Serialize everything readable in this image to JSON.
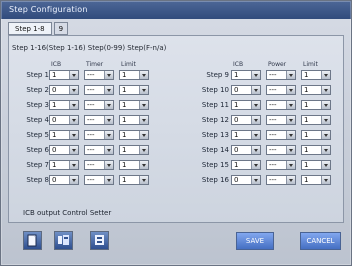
{
  "window": {
    "title": "Step Configuration"
  },
  "tabs": [
    {
      "label": "Step 1-8"
    },
    {
      "label": "9"
    }
  ],
  "header": {
    "text": "Step 1-16(Step 1-16) Step(0-99) Step(F-n/a)"
  },
  "columns": {
    "left": [
      "ICB",
      "Timer",
      "Limit"
    ],
    "right": [
      "ICB",
      "Power",
      "Limit"
    ]
  },
  "rows": {
    "left": [
      {
        "label": "Step 1",
        "values": [
          "1",
          "---",
          "1"
        ]
      },
      {
        "label": "Step 2",
        "values": [
          "0",
          "---",
          "1"
        ]
      },
      {
        "label": "Step 3",
        "values": [
          "1",
          "---",
          "1"
        ]
      },
      {
        "label": "Step 4",
        "values": [
          "0",
          "---",
          "1"
        ]
      },
      {
        "label": "Step 5",
        "values": [
          "1",
          "---",
          "1"
        ]
      },
      {
        "label": "Step 6",
        "values": [
          "0",
          "---",
          "1"
        ]
      },
      {
        "label": "Step 7",
        "values": [
          "1",
          "---",
          "1"
        ]
      },
      {
        "label": "Step 8",
        "values": [
          "0",
          "---",
          "1"
        ]
      }
    ],
    "right": [
      {
        "label": "Step 9",
        "values": [
          "1",
          "---",
          "1"
        ]
      },
      {
        "label": "Step 10",
        "values": [
          "0",
          "---",
          "1"
        ]
      },
      {
        "label": "Step 11",
        "values": [
          "1",
          "---",
          "1"
        ]
      },
      {
        "label": "Step 12",
        "values": [
          "0",
          "---",
          "1"
        ]
      },
      {
        "label": "Step 13",
        "values": [
          "1",
          "---",
          "1"
        ]
      },
      {
        "label": "Step 14",
        "values": [
          "0",
          "---",
          "1"
        ]
      },
      {
        "label": "Step 15",
        "values": [
          "1",
          "---",
          "1"
        ]
      },
      {
        "label": "Step 16",
        "values": [
          "0",
          "---",
          "1"
        ]
      }
    ]
  },
  "status": {
    "text": "ICB output Control Setter"
  },
  "buttons": {
    "save": "SAVE",
    "cancel": "CANCEL"
  },
  "icons": {
    "left_button_1": "document-icon",
    "left_button_2": "tool-icon",
    "left_button_3": "settings-icon"
  },
  "colors": {
    "accent": "#456fc2",
    "titlebar": "#314b7c",
    "panel": "#d8dde7"
  }
}
